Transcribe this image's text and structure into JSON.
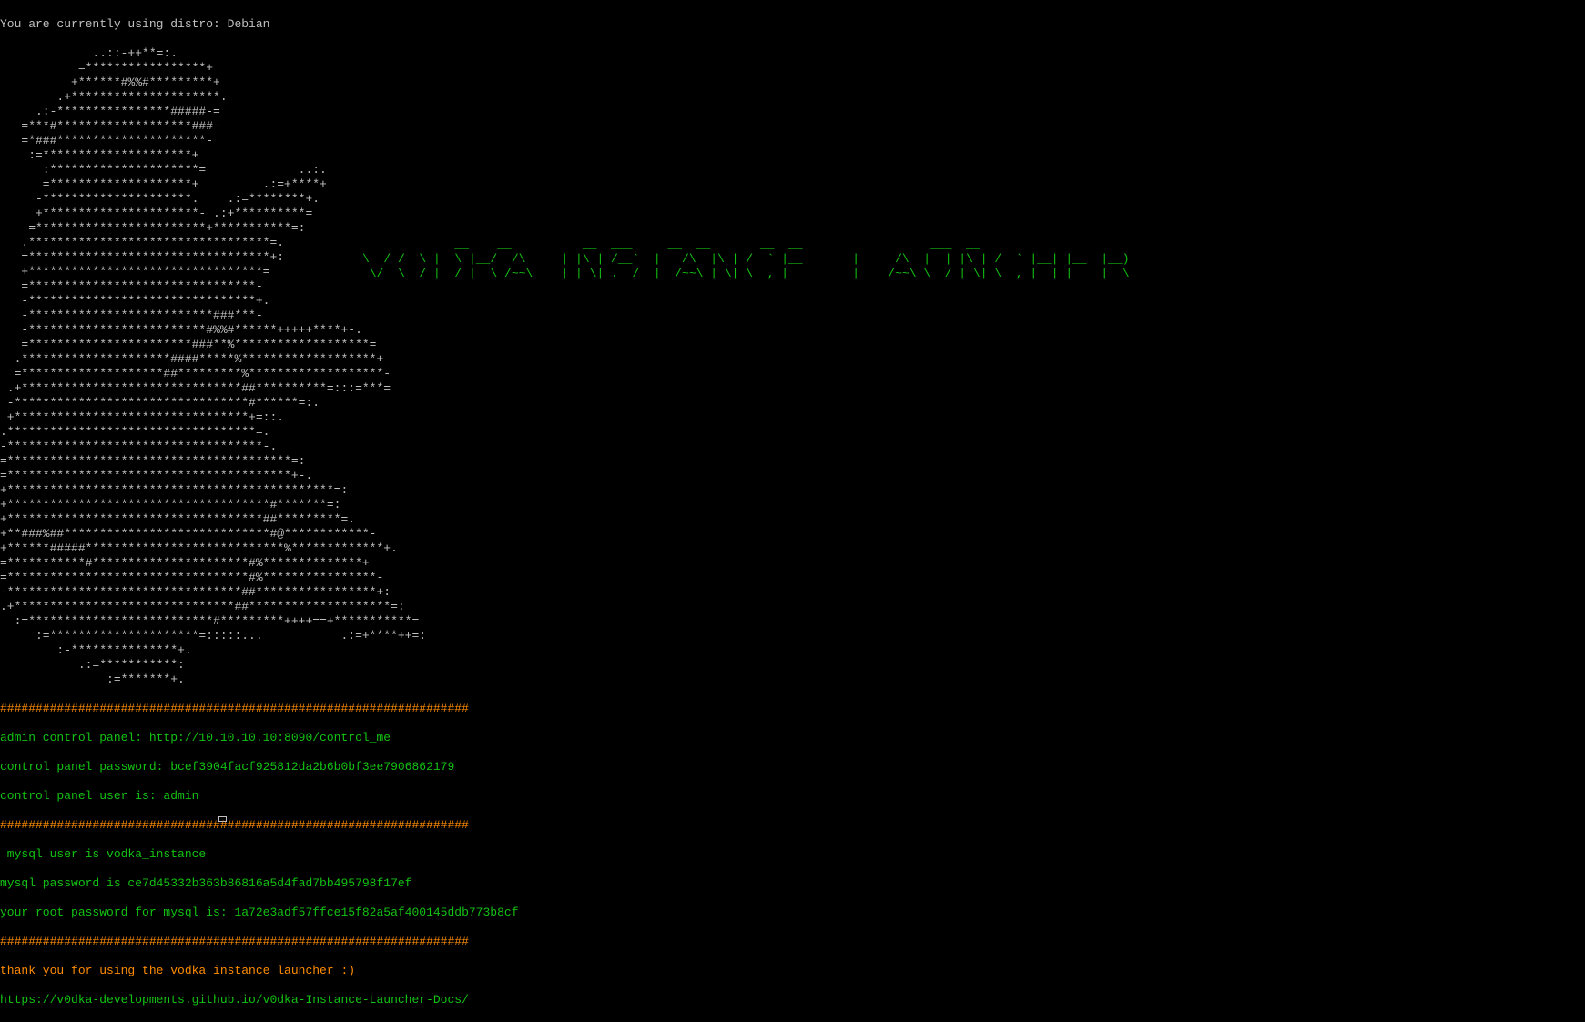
{
  "terminal": {
    "distro_line": "You are currently using distro: Debian",
    "ascii_art": [
      "             ..::-++**=:.",
      "           =*****************+",
      "          +******#%%#*********+",
      "        .+*********************.",
      "     .:-****************#####-=",
      "   =***#*******************###-",
      "   =*###*********************-",
      "    :=*********************+",
      "      :*********************=             ..:.",
      "      =********************+         .:=+****+",
      "     -*********************.    .:=********+.",
      "     +**********************- .:+**********=",
      "    =************************+***********=:",
      "   .**********************************=.",
      "   =**********************************+:",
      "   +*********************************=",
      "   =********************************-",
      "   -********************************+.",
      "   -**************************###***-",
      "   -*************************#%%#******+++++****+-.",
      "   =***********************###**%*******************=",
      "  .*********************####*****%*******************+",
      "  =********************##*********%*******************-",
      " .+*******************************##**********=:::=***=",
      " -*********************************#******=:.",
      " +*********************************+=::.",
      ".***********************************=.",
      "-************************************-.",
      "=****************************************=:",
      "=****************************************+-.",
      "+**********************************************=:",
      "+*************************************#*******=:",
      "+************************************##*********=.",
      "+**###%##*****************************#@************-",
      "+******#####****************************%*************+.",
      "=***********#**********************#%**************+",
      "=**********************************#%****************-",
      "-*********************************##*****************+:",
      ".+*******************************##********************=:",
      "  :=**************************#*********++++==+***********=",
      "     :=*********************=:::::...           .:=+****++=:",
      "        :-***************+.",
      "           .:=***********:",
      "               :=*******+."
    ],
    "separator": "##################################################################",
    "admin_panel": "admin control panel: http://10.10.10.10:8090/control_me",
    "panel_password": "control panel password: bcef3904facf925812da2b6b0bf3ee7906862179",
    "panel_user": "control panel user is: admin",
    "mysql_user": " mysql user is vodka_instance",
    "mysql_password": "mysql password is ce7d45332b363b86816a5d4fad7bb495798f17ef",
    "mysql_root": "your root password for mysql is: 1a72e3adf57ffce15f82a5af400145ddb773b8cf",
    "thanks": "thank you for using the vodka instance launcher :)",
    "docs_url": "https://v0dka-developments.github.io/v0dka-Instance-Launcher-Docs/",
    "banner": [
      "             __    __          __  ___     __  __       __  __                  ___  __",
      "\\  / /  \\ |  \\ |__/  /\\     | |\\ | /__`  |   /\\  |\\ | /  ` |__       |     /\\  |  | |\\ | /  ` |__| |__  |__)",
      " \\/  \\__/ |__/ |  \\ /~~\\    | | \\| .__/  |  /~~\\ | \\| \\__, |___      |___ /~~\\ \\__/ | \\| \\__, |  | |___ |  \\"
    ],
    "colors": {
      "background": "#000000",
      "text": "#c0c0c0",
      "green": "#13c213",
      "orange": "#ff8c00"
    }
  }
}
